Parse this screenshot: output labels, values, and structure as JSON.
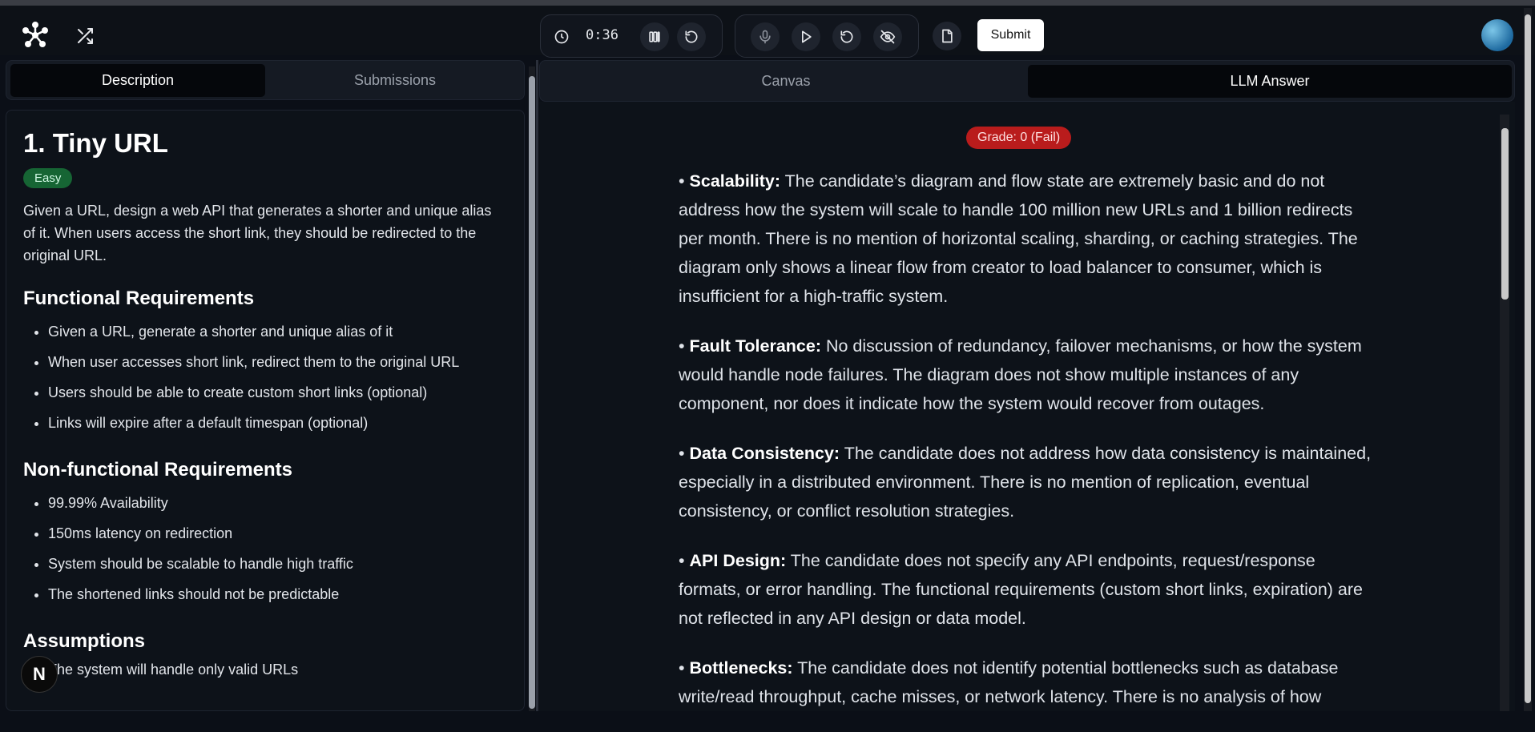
{
  "toolbar": {
    "timer": "0:36",
    "submit_label": "Submit"
  },
  "left_tabs": [
    {
      "label": "Description",
      "active": true
    },
    {
      "label": "Submissions",
      "active": false
    }
  ],
  "problem": {
    "title": "1. Tiny URL",
    "difficulty": "Easy",
    "description": "Given a URL, design a web API that generates a shorter and unique alias of it. When users access the short link, they should be redirected to the original URL.",
    "functional_heading": "Functional Requirements",
    "functional": [
      "Given a URL, generate a shorter and unique alias of it",
      "When user accesses short link, redirect them to the original URL",
      "Users should be able to create custom short links (optional)",
      "Links will expire after a default timespan (optional)"
    ],
    "nonfunctional_heading": "Non-functional Requirements",
    "nonfunctional": [
      "99.99% Availability",
      "150ms latency on redirection",
      "System should be scalable to handle high traffic",
      "The shortened links should not be predictable"
    ],
    "assumptions_heading": "Assumptions",
    "assumptions": [
      "The system will handle only valid URLs"
    ]
  },
  "fab_label": "N",
  "right_tabs": [
    {
      "label": "Canvas",
      "active": false
    },
    {
      "label": "LLM Answer",
      "active": true
    }
  ],
  "grade": "Grade: 0 (Fail)",
  "answer": [
    {
      "title": "Scalability:",
      "text": "The candidate’s diagram and flow state are extremely basic and do not address how the system will scale to handle 100 million new URLs and 1 billion redirects per month. There is no mention of horizontal scaling, sharding, or caching strategies. The diagram only shows a linear flow from creator to load balancer to consumer, which is insufficient for a high-traffic system."
    },
    {
      "title": "Fault Tolerance:",
      "text": "No discussion of redundancy, failover mechanisms, or how the system would handle node failures. The diagram does not show multiple instances of any component, nor does it indicate how the system would recover from outages."
    },
    {
      "title": "Data Consistency:",
      "text": "The candidate does not address how data consistency is maintained, especially in a distributed environment. There is no mention of replication, eventual consistency, or conflict resolution strategies."
    },
    {
      "title": "API Design:",
      "text": "The candidate does not specify any API endpoints, request/response formats, or error handling. The functional requirements (custom short links, expiration) are not reflected in any API design or data model."
    },
    {
      "title": "Bottlenecks:",
      "text": "The candidate does not identify potential bottlenecks such as database write/read throughput, cache misses, or network latency. There is no analysis of how"
    }
  ],
  "icons": [
    "logo-icon",
    "shuffle-icon",
    "clock-icon",
    "pause-icon",
    "restart-icon",
    "microphone-icon",
    "play-icon",
    "replay-icon",
    "eye-off-icon",
    "document-icon",
    "avatar"
  ]
}
